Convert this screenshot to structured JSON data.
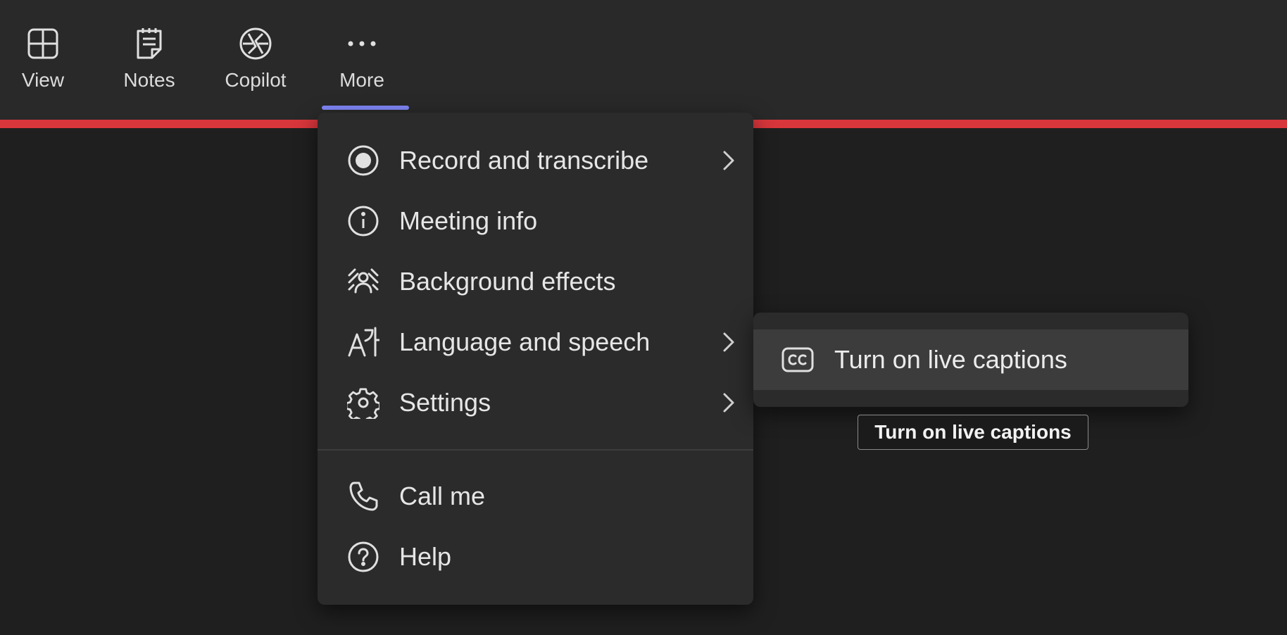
{
  "toolbar": {
    "buttons": [
      {
        "label": "View",
        "icon": "view-grid-icon"
      },
      {
        "label": "Notes",
        "icon": "notes-icon"
      },
      {
        "label": "Copilot",
        "icon": "copilot-icon"
      },
      {
        "label": "More",
        "icon": "more-dots-icon",
        "active": true
      }
    ]
  },
  "more_menu": {
    "items": [
      {
        "label": "Record and transcribe",
        "icon": "record-icon",
        "has_submenu": true
      },
      {
        "label": "Meeting info",
        "icon": "info-icon",
        "has_submenu": false
      },
      {
        "label": "Background effects",
        "icon": "background-effects-icon",
        "has_submenu": false
      },
      {
        "label": "Language and speech",
        "icon": "language-icon",
        "has_submenu": true
      },
      {
        "label": "Settings",
        "icon": "gear-icon",
        "has_submenu": true
      },
      {
        "label": "Call me",
        "icon": "phone-icon",
        "has_submenu": false
      },
      {
        "label": "Help",
        "icon": "help-icon",
        "has_submenu": false
      }
    ]
  },
  "language_submenu": {
    "items": [
      {
        "label": "Turn on live captions",
        "icon": "closed-captions-icon"
      }
    ]
  },
  "tooltip": {
    "text": "Turn on live captions"
  },
  "colors": {
    "accent_underline": "#7f85f5",
    "recording_bar": "#d7363b",
    "background": "#1f1f1f",
    "menu_bg": "#2b2b2b"
  }
}
